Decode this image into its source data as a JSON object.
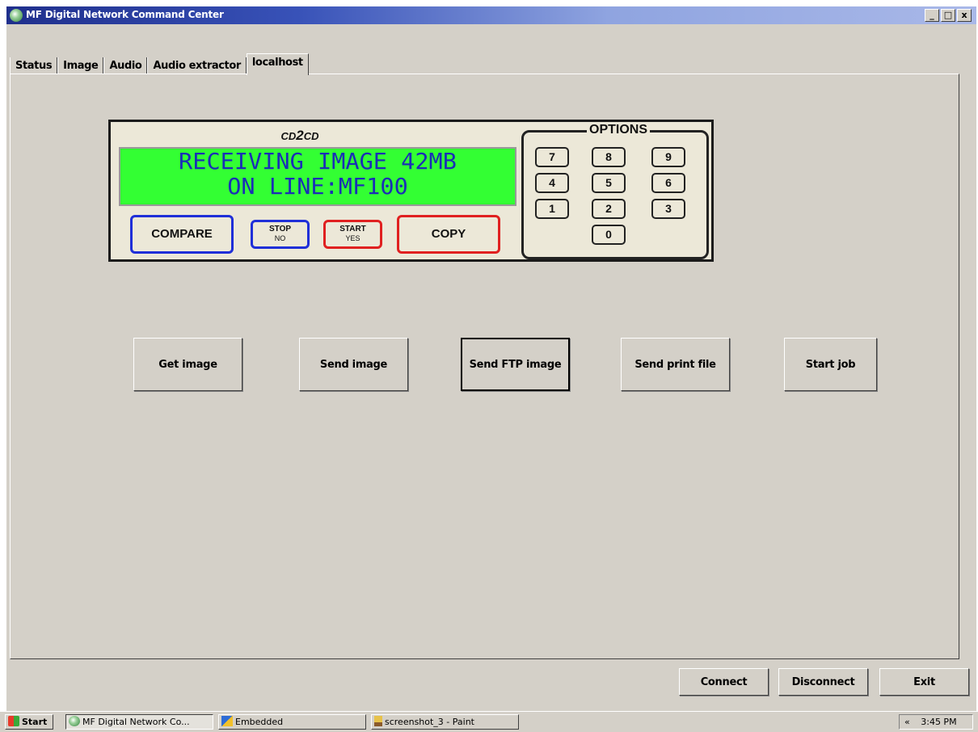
{
  "window": {
    "title": "MF Digital Network Command Center",
    "controls": {
      "minimize": "_",
      "maximize": "□",
      "close": "x"
    }
  },
  "tabs": [
    {
      "label": "Status"
    },
    {
      "label": "Image"
    },
    {
      "label": "Audio"
    },
    {
      "label": "Audio extractor"
    },
    {
      "label": "localhost",
      "active": true
    }
  ],
  "device_panel": {
    "logo_left": "CD",
    "logo_mid": "2",
    "logo_right": "CD",
    "lcd_line1": "RECEIVING IMAGE 42MB",
    "lcd_line2": "ON LINE:MF100",
    "compare_label": "COMPARE",
    "stop_label": "STOP",
    "stop_sub": "NO",
    "start_label": "START",
    "start_sub": "YES",
    "copy_label": "COPY",
    "options_label": "OPTIONS",
    "keys": [
      "7",
      "8",
      "9",
      "4",
      "5",
      "6",
      "1",
      "2",
      "3",
      "0"
    ],
    "colors": {
      "lcd": "#33ff33",
      "lcd_text": "#1a2fb6",
      "compare_border": "#1f2fd8",
      "stop_border": "#1f2fd8",
      "start_border": "#e02020",
      "copy_border": "#e02020"
    }
  },
  "actions": [
    {
      "label": "Get image"
    },
    {
      "label": "Send image"
    },
    {
      "label": "Send FTP image",
      "focused": true
    },
    {
      "label": "Send print file"
    },
    {
      "label": "Start job"
    }
  ],
  "bottom_buttons": {
    "connect": "Connect",
    "disconnect": "Disconnect",
    "exit": "Exit"
  },
  "taskbar": {
    "start": "Start",
    "items": [
      {
        "label": "MF Digital Network Co...",
        "icon": "app-icon",
        "pressed": true
      },
      {
        "label": "Embedded",
        "icon": "embedded-icon"
      },
      {
        "label": "screenshot_3 - Paint",
        "icon": "paint-icon"
      }
    ],
    "tray_arrow": "«",
    "clock": "3:45 PM"
  }
}
